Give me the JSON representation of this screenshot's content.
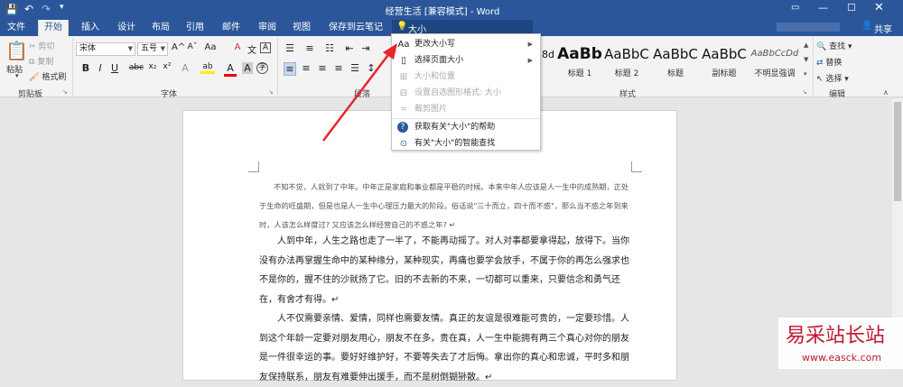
{
  "titlebar": {
    "title": "经营生活 [兼容模式] - Word",
    "qat_save": "💾",
    "qat_undo": "↶",
    "qat_redo": "↷"
  },
  "tabs": [
    "文件",
    "开始",
    "插入",
    "设计",
    "布局",
    "引用",
    "邮件",
    "审阅",
    "视图",
    "保存到云笔记"
  ],
  "active_tab": "开始",
  "search": {
    "value": "大小",
    "icon": "lightbulb-icon"
  },
  "share_label": "共享",
  "clipboard": {
    "paste": "粘贴",
    "cut": "剪切",
    "copy": "复制",
    "format_painter": "格式刷",
    "group": "剪贴板"
  },
  "font": {
    "name": "宋体",
    "size": "五号",
    "group": "字体",
    "bold": "B",
    "italic": "I",
    "underline": "U",
    "strike": "abc",
    "sub": "x₂",
    "sup": "x²",
    "grow": "A^",
    "shrink": "Aˇ",
    "case": "Aa",
    "clear": "A",
    "wen": "文",
    "highlight": "ab",
    "color": "A",
    "wen2": "A",
    "circle": "字"
  },
  "paragraph": {
    "group": "段落"
  },
  "styles": {
    "group": "样式",
    "items": [
      {
        "sample": "AaBb",
        "label": "标题 1"
      },
      {
        "sample": "AaBbC",
        "label": "标题 2"
      },
      {
        "sample": "AaBbC",
        "label": "标题"
      },
      {
        "sample": "AaBbC",
        "label": "副标题"
      },
      {
        "sample": "AaBbCcDd",
        "label": "不明显强调"
      }
    ],
    "partial_label": "8d"
  },
  "editing": {
    "find": "查找",
    "replace": "替换",
    "select": "选择",
    "group": "编辑"
  },
  "menu": {
    "items": [
      {
        "label": "更改大小写",
        "disabled": false,
        "submenu": true,
        "icon": "aa-icon"
      },
      {
        "label": "选择页面大小",
        "disabled": false,
        "submenu": true,
        "icon": "page-size-icon"
      },
      {
        "label": "大小和位置",
        "disabled": true,
        "submenu": false,
        "icon": "size-position-icon"
      },
      {
        "label": "设置自选图形格式: 大小",
        "disabled": true,
        "submenu": false,
        "icon": "shape-format-icon"
      },
      {
        "label": "裁剪图片",
        "disabled": true,
        "submenu": false,
        "icon": "crop-icon"
      },
      {
        "label": "获取有关\"大小\"的帮助",
        "disabled": false,
        "submenu": false,
        "icon": "help-icon"
      },
      {
        "label": "有关\"大小\"的智能查找",
        "disabled": false,
        "submenu": false,
        "icon": "smart-lookup-icon"
      }
    ]
  },
  "doc": {
    "para1": "不知不觉，人就到了中年。中年正是家庭和事业都是平稳的时候。本来中年人应该是人一生中的成熟期，正处于生命的旺盛期，但是也是人一生中心理压力最大的阶段。俗话说\"三十而立，四十而不惑\"，那么当不惑之年到来时，人该怎么样度过? 又应该怎么样经营自己的不惑之年? ↵",
    "para2": "人到中年，人生之路也走了一半了，不能再动摇了。对人对事都要拿得起，放得下。当你没有办法再掌握生命中的某种缘分，某种现实，再痛也要学会放手，不属于你的再怎么强求也不是你的，握不住的沙就扬了它。旧的不去新的不来，一切都可以重来，只要信念和勇气还在，有舍才有得。↵",
    "para3": "人不仅需要亲情、爱情，同样也需要友情。真正的友谊是很难能可贵的，一定要珍惜。人到这个年龄一定要对朋友用心，朋友不在多，贵在真，人一生中能拥有两三个真心对你的朋友是一件很幸运的事。要好好维护好，不要等失去了才后悔。拿出你的真心和忠诚，平时多和朋友保持联系，朋友有难要伸出援手，而不是树倒猢狲散。↵"
  },
  "watermark": {
    "text": "易采站长站",
    "url": "www.easck.com"
  }
}
